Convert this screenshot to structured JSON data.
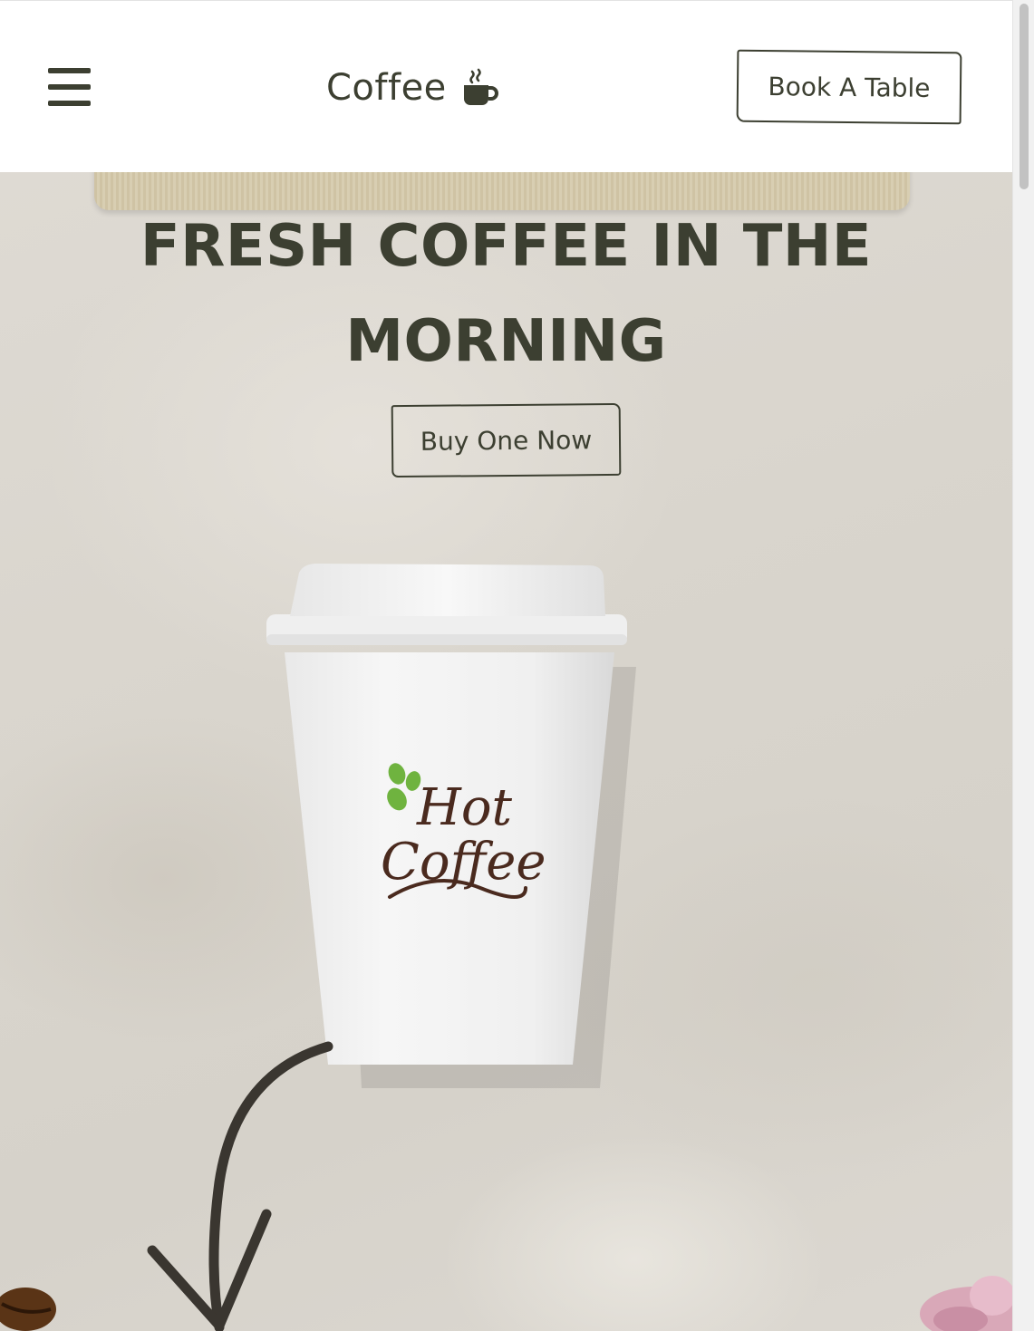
{
  "header": {
    "menu_icon": "hamburger-menu-icon",
    "brand": "Coffee",
    "brand_icon": "coffee-mug-icon",
    "book_button": "Book A Table"
  },
  "hero": {
    "title": "FRESH COFFEE IN THE MORNING",
    "cta_button": "Buy One Now",
    "cup_logo_line1": "Hot",
    "cup_logo_line2": "Coffee"
  },
  "colors": {
    "text": "#3c3f31",
    "background": "#ffffff",
    "hero_bg": "#dbd7cf",
    "logo_brown": "#4a2a1e",
    "logo_green": "#6fb33f"
  }
}
